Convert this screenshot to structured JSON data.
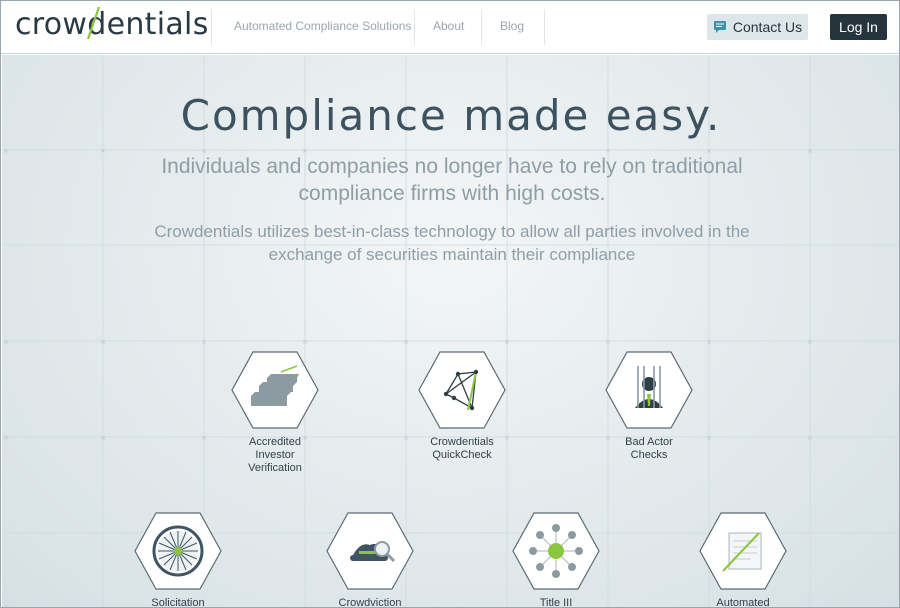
{
  "header": {
    "logo_text": "crowdentials",
    "nav": [
      {
        "label": "Automated Compliance Solutions"
      },
      {
        "label": "About"
      },
      {
        "label": "Blog"
      }
    ],
    "contact_label": "Contact Us",
    "login_label": "Log In"
  },
  "hero": {
    "title": "Compliance made easy.",
    "subtitle": "Individuals and companies no longer have to rely on traditional compliance firms with high costs.",
    "description": "Crowdentials utilizes best-in-class technology to allow all parties involved in the exchange of securities maintain their compliance"
  },
  "features": [
    {
      "label": "Accredited\nInvestor\nVerification",
      "icon": "stairs-icon"
    },
    {
      "label": "Crowdentials\nQuickCheck",
      "icon": "network-icon"
    },
    {
      "label": "Bad Actor\nChecks",
      "icon": "jailed-person-icon"
    },
    {
      "label": "Solicitation",
      "icon": "wheel-icon"
    },
    {
      "label": "Crowdviction",
      "icon": "detective-hat-icon"
    },
    {
      "label": "Title III",
      "icon": "hub-nodes-icon"
    },
    {
      "label": "Automated",
      "icon": "document-pen-icon"
    }
  ],
  "colors": {
    "brand_dark": "#26343d",
    "accent_green": "#8cc63f",
    "hex_fill": "#ffffff",
    "hex_stroke": "#5b6b74"
  }
}
